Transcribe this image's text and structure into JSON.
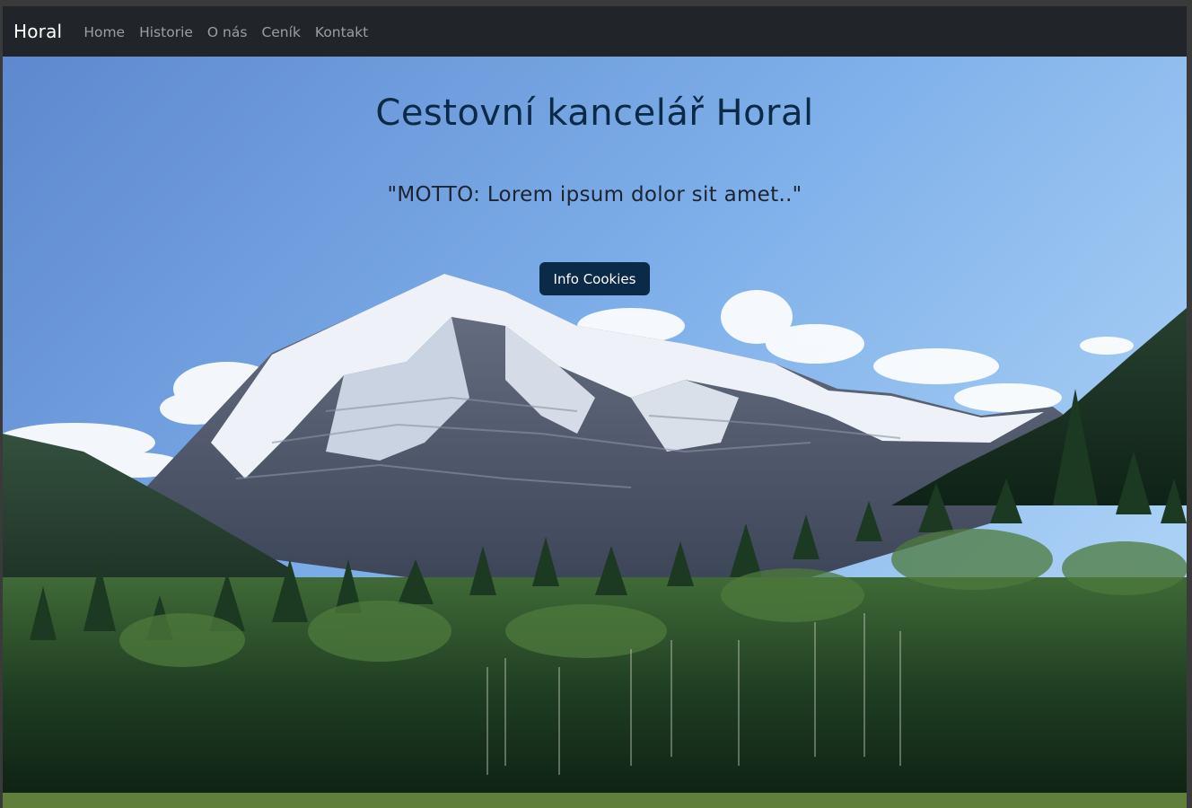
{
  "navbar": {
    "brand": "Horal",
    "links": [
      {
        "label": "Home"
      },
      {
        "label": "Historie"
      },
      {
        "label": "O nás"
      },
      {
        "label": "Ceník"
      },
      {
        "label": "Kontakt"
      }
    ],
    "background_color": "#212529"
  },
  "hero": {
    "title": "Cestovní kancelář Horal",
    "motto": "\"MOTTO: Lorem ipsum dolor sit amet..\"",
    "button_label": "Info Cookies",
    "accent_color": "#0b2a47"
  }
}
